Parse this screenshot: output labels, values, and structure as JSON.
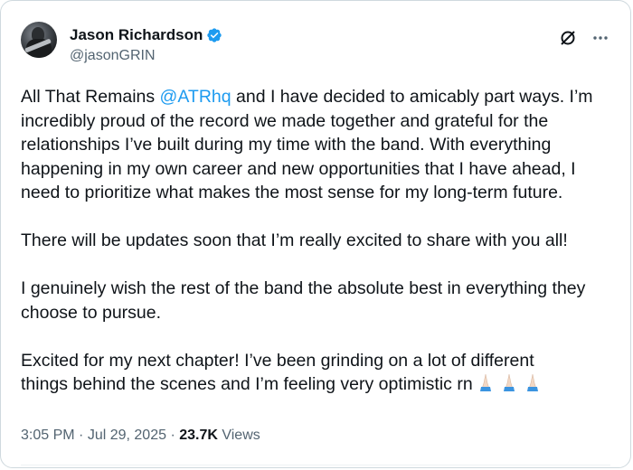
{
  "author": {
    "name": "Jason Richardson",
    "handle": "@jasonGRIN",
    "verified_color": "#1d9bf0"
  },
  "actions": {
    "grok_icon": "grok-icon",
    "more_icon": "more-icon"
  },
  "tweet": {
    "p1_prefix": "All That Remains ",
    "p1_mention": "@ATRhq",
    "p1_line1_rest": " and I have decided to amicably part ways. I’m",
    "p1_line2": "incredibly proud of the record we made together and grateful for the",
    "p1_line3": "relationships I’ve built during my time with the band. With everything",
    "p1_line4": "happening in my own career and new opportunities that I have ahead, I",
    "p1_line5": "need to prioritize what makes the most sense for my long-term future.",
    "p2": "There will be updates soon that I’m really excited to share with you all!",
    "p3_line1": "I genuinely wish the rest of the band the absolute best in everything they",
    "p3_line2": "choose to pursue.",
    "p4_line1": "Excited for my next chapter!  I’ve been grinding on a lot of different",
    "p4_line2": "things behind the scenes and I’m feeling very optimistic rn ",
    "emoji": "praying-hands-emoji x3"
  },
  "meta": {
    "time": "3:05 PM",
    "sep1": " · ",
    "date": "Jul 29, 2025",
    "sep2": " · ",
    "views_count": "23.7K",
    "views_label": " Views"
  }
}
